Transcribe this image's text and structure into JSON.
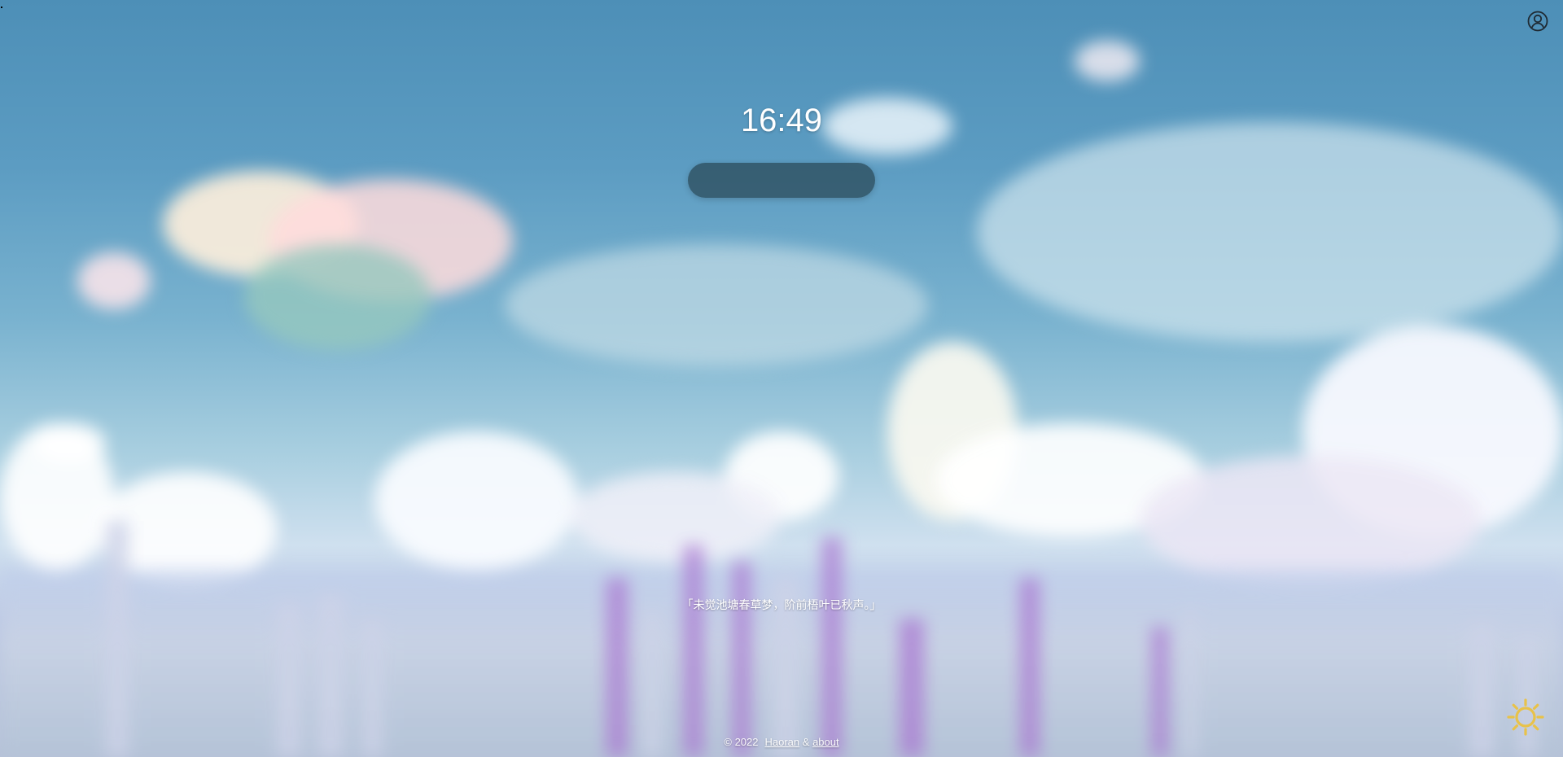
{
  "clock": {
    "time": "16:49"
  },
  "search": {
    "value": "",
    "placeholder": ""
  },
  "quote": {
    "text": "「未觉池塘春草梦，阶前梧叶已秋声。」"
  },
  "footer": {
    "copyright": "© 2022",
    "author_link": "Haoran",
    "separator": "&",
    "about_link": "about"
  },
  "icons": {
    "user": "user-circle-icon",
    "theme": "sun-icon"
  },
  "colors": {
    "sun": "#e8c24a",
    "search_bg": "#2e5566",
    "text": "#ffffff"
  }
}
